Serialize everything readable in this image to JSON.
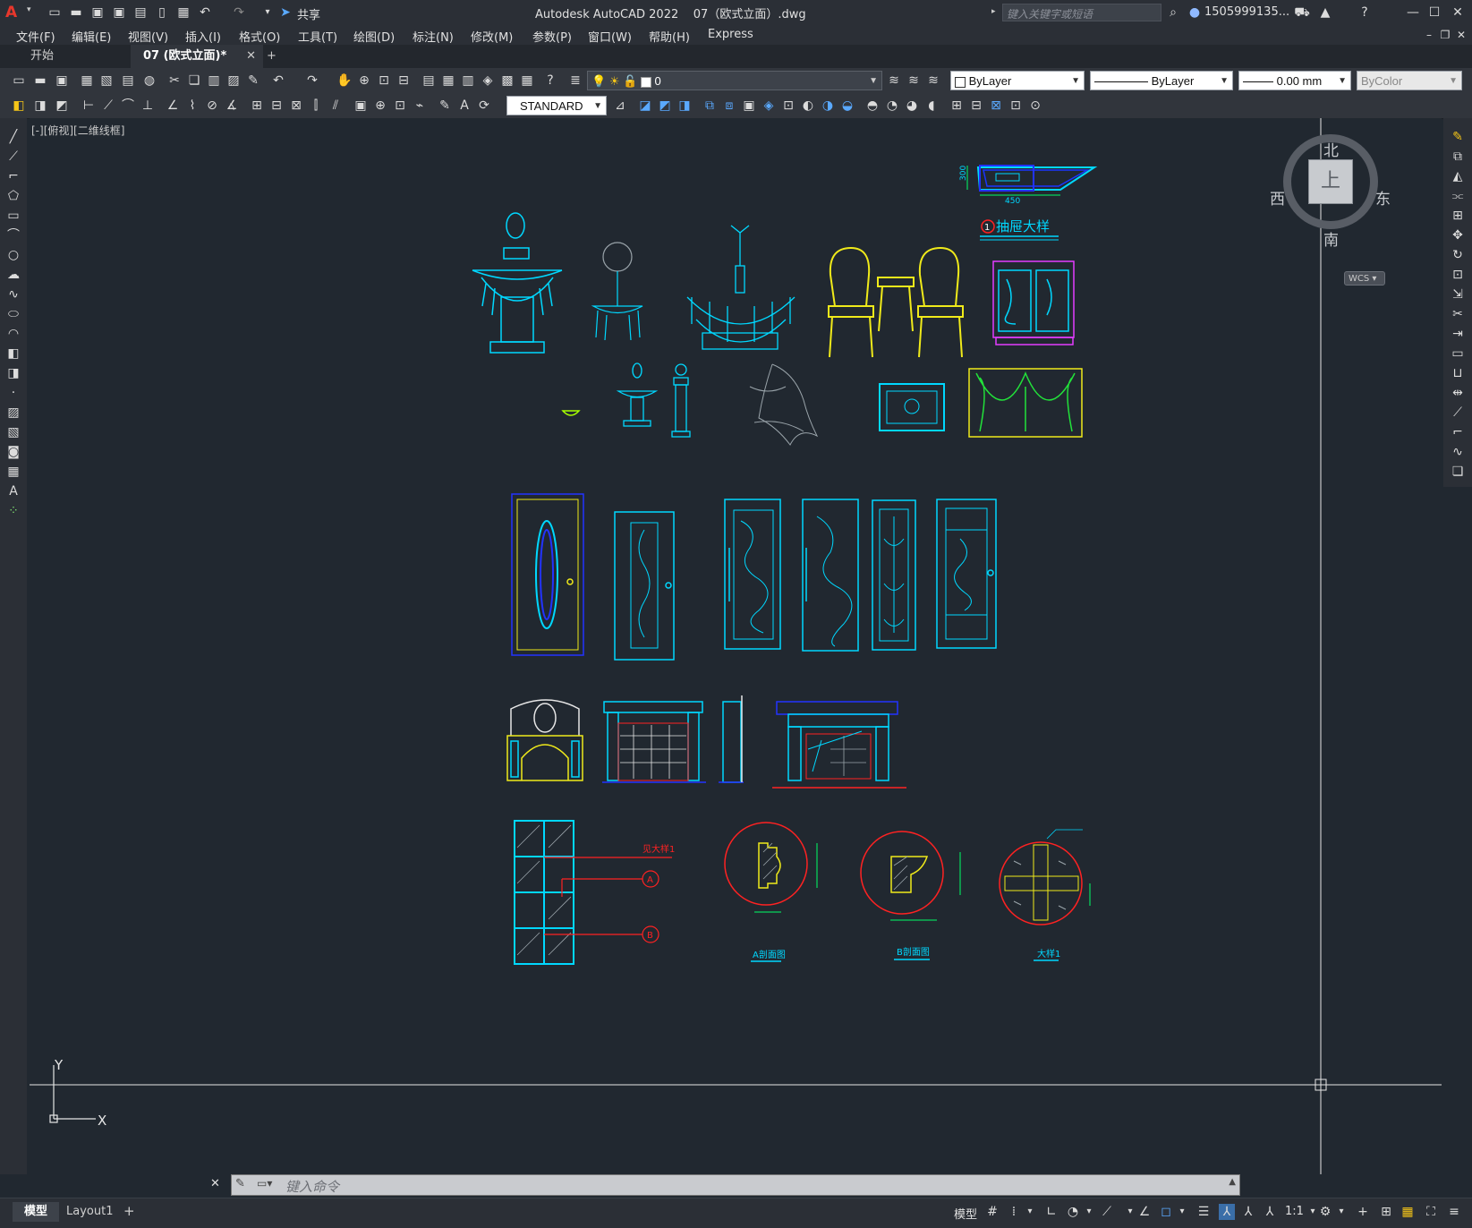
{
  "app": {
    "title": "Autodesk AutoCAD 2022    07（欧式立面）.dwg",
    "share_label": "共享",
    "search_placeholder": "键入关键字或短语",
    "user_name": "1505999135..."
  },
  "menu": [
    "文件(F)",
    "编辑(E)",
    "视图(V)",
    "插入(I)",
    "格式(O)",
    "工具(T)",
    "绘图(D)",
    "标注(N)",
    "修改(M)",
    "参数(P)",
    "窗口(W)",
    "帮助(H)",
    "Express"
  ],
  "tabs": {
    "start": "开始",
    "active": "07 (欧式立面)*",
    "add": "+"
  },
  "toolbar": {
    "layer_value": "0",
    "color_value": "ByLayer",
    "linetype_value": "ByLayer",
    "lineweight_value": "0.00 mm",
    "plotstyle_value": "ByColor",
    "textstyle_value": "STANDARD"
  },
  "viewport_label": "[-][俯视][二维线框]",
  "viewcube": {
    "north": "北",
    "south": "南",
    "east": "东",
    "west": "西",
    "face": "上",
    "wcs": "WCS"
  },
  "drawing": {
    "drawer_title": "抽屉大样",
    "drawer_num": "1",
    "dim_450": "450",
    "dim_300": "300",
    "callout_see_detail": "见大样1",
    "callout_a": "A",
    "callout_b": "B",
    "section_a": "A剖面图",
    "section_b": "B剖面图",
    "detail_1": "大样1"
  },
  "ucs": {
    "x": "X",
    "y": "Y"
  },
  "command": {
    "placeholder": "键入命令"
  },
  "layout_tabs": {
    "model": "模型",
    "layout1": "Layout1",
    "add": "+"
  },
  "status": {
    "model": "模型",
    "scale": "1:1"
  }
}
